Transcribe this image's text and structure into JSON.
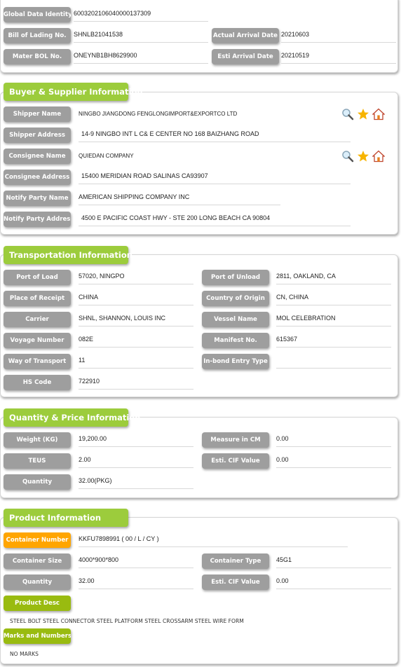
{
  "header": {
    "global_data_identity": {
      "label": "Global Data Identity",
      "value": "6003202106040000137309"
    },
    "bill_of_lading": {
      "label": "Bill of Lading No.",
      "value": "SHNLB21041538"
    },
    "master_bol": {
      "label": "Mater BOL No.",
      "value": "ONEYNB1BH8629900"
    },
    "actual_arrival_date": {
      "label": "Actual Arrival Date",
      "value": "20210603"
    },
    "esti_arrival_date": {
      "label": "Esti Arrival Date",
      "value": "20210519"
    }
  },
  "buyer_supplier": {
    "title": "Buyer & Supplier Information",
    "shipper_name": {
      "label": "Shipper Name",
      "value": "NINGBO JIANGDONG FENGLONGIMPORT&EXPORTCO LTD"
    },
    "shipper_address": {
      "label": "Shipper Address",
      "value": "14-9 NINGBO INT L C& E CENTER NO 168 BAIZHANG ROAD"
    },
    "consignee_name": {
      "label": "Consignee Name",
      "value": "QUIEDAN COMPANY"
    },
    "consignee_address": {
      "label": "Consignee Address",
      "value": "15400 MERIDIAN ROAD SALINAS CA93907"
    },
    "notify_party_name": {
      "label": "Notify Party Name",
      "value": "AMERICAN SHIPPING COMPANY INC"
    },
    "notify_party_address": {
      "label": "Notify Party Address",
      "value": "4500 E PACIFIC COAST HWY - STE 200 LONG BEACH CA 90804"
    },
    "icons": [
      "search-icon",
      "star-icon",
      "home-icon"
    ]
  },
  "transportation": {
    "title": "Transportation Information",
    "port_of_load": {
      "label": "Port of Load",
      "value": "57020, NINGPO"
    },
    "port_of_unload": {
      "label": "Port of Unload",
      "value": "2811, OAKLAND, CA"
    },
    "place_of_receipt": {
      "label": "Place of Receipt",
      "value": "CHINA"
    },
    "country_of_origin": {
      "label": "Country of Origin",
      "value": "CN, CHINA"
    },
    "carrier": {
      "label": "Carrier",
      "value": "SHNL, SHANNON, LOUIS INC"
    },
    "vessel_name": {
      "label": "Vessel Name",
      "value": "MOL CELEBRATION"
    },
    "voyage_number": {
      "label": "Voyage Number",
      "value": "082E"
    },
    "manifest_no": {
      "label": "Manifest No.",
      "value": "615367"
    },
    "way_of_transport": {
      "label": "Way of Transport",
      "value": "11"
    },
    "in_bond_entry_type": {
      "label": "In-bond Entry Type",
      "value": ""
    },
    "hs_code": {
      "label": "HS Code",
      "value": "722910"
    }
  },
  "quantity_price": {
    "title": "Quantity & Price Information",
    "weight": {
      "label": "Weight (KG)",
      "value": "19,200.00"
    },
    "measure": {
      "label": "Measure in CM",
      "value": "0.00"
    },
    "teus": {
      "label": "TEUS",
      "value": "2.00"
    },
    "esti_cif_value": {
      "label": "Esti. CIF Value",
      "value": "0.00"
    },
    "quantity": {
      "label": "Quantity",
      "value": "32.00(PKG)"
    }
  },
  "product": {
    "title": "Product Information",
    "container_number": {
      "label": "Container Number",
      "value": "KKFU7898991 ( 00 / L / CY )"
    },
    "container_size": {
      "label": "Container Size",
      "value": "4000*900*800"
    },
    "container_type": {
      "label": "Container Type",
      "value": "45G1"
    },
    "quantity": {
      "label": "Quantity",
      "value": "32.00"
    },
    "esti_cif_value": {
      "label": "Esti. CIF Value",
      "value": "0.00"
    },
    "product_desc": {
      "label": "Product Desc",
      "value": "STEEL BOLT STEEL CONNECTOR STEEL PLATFORM STEEL CROSSARM STEEL WIRE FORM"
    },
    "marks_numbers": {
      "label": "Marks and Numbers",
      "value": "NO MARKS"
    }
  },
  "colors": {
    "section_green": "#9ccc3c",
    "label_gray": "#9e9e9e",
    "label_orange": "#ffa500",
    "label_olive": "#99bb10"
  }
}
